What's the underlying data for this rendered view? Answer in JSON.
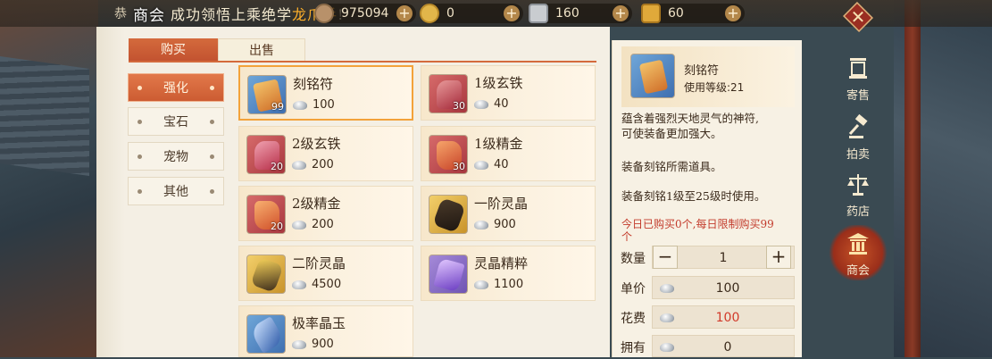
{
  "header": {
    "title": "商会",
    "announcement_prefix": "恭",
    "announcement_mid": "成功领悟上乘绝学",
    "announcement_highlight": "龙爪手",
    "announcement_end": "!"
  },
  "currencies": [
    {
      "name": "coin",
      "value": "975094",
      "icon": "coin-icon",
      "color": "#b8916a"
    },
    {
      "name": "gold-ingot",
      "value": "0",
      "icon": "gold-coin-icon",
      "color": "#e2b64a"
    },
    {
      "name": "silver-bar",
      "value": "160",
      "icon": "silver-bar-icon",
      "color": "#c9ccd0"
    },
    {
      "name": "gold-bar",
      "value": "60",
      "icon": "gold-bar-icon",
      "color": "#e0a93a"
    }
  ],
  "tabs": {
    "buy": "购买",
    "sell": "出售"
  },
  "categories": [
    "强化",
    "宝石",
    "宠物",
    "其他"
  ],
  "items": [
    {
      "name": "刻铭符",
      "price": "100",
      "count": "99",
      "bg": "blue",
      "icon": "talisman-icon"
    },
    {
      "name": "1级玄铁",
      "price": "40",
      "count": "30",
      "bg": "red",
      "icon": "iron-ore-icon"
    },
    {
      "name": "2级玄铁",
      "price": "200",
      "count": "20",
      "bg": "red",
      "icon": "iron-ore-icon"
    },
    {
      "name": "1级精金",
      "price": "40",
      "count": "30",
      "bg": "red",
      "icon": "gold-ore-icon"
    },
    {
      "name": "2级精金",
      "price": "200",
      "count": "20",
      "bg": "red",
      "icon": "gold-ore-icon"
    },
    {
      "name": "一阶灵晶",
      "price": "900",
      "count": "",
      "bg": "gold",
      "icon": "crystal-icon"
    },
    {
      "name": "二阶灵晶",
      "price": "4500",
      "count": "",
      "bg": "gold",
      "icon": "crystal-icon"
    },
    {
      "name": "灵晶精粹",
      "price": "1100",
      "count": "",
      "bg": "purple",
      "icon": "essence-icon"
    },
    {
      "name": "极率晶玉",
      "price": "900",
      "count": "",
      "bg": "blue",
      "icon": "jade-icon"
    }
  ],
  "detail": {
    "name": "刻铭符",
    "level_label": "使用等级:",
    "level": "21",
    "desc1_line1": "蕴含着强烈天地灵气的神符,",
    "desc1_line2": "可使装备更加强大。",
    "desc2": "装备刻铭所需道具。",
    "desc3": "装备刻铭1级至25级时使用。",
    "limit_line1": "今日已购买0个,每日限制购买99",
    "limit_line2": "个",
    "qty_label": "数量",
    "qty_value": "1",
    "minus": "−",
    "plus": "+",
    "unit_label": "单价",
    "unit_value": "100",
    "cost_label": "花费",
    "cost_value": "100",
    "own_label": "拥有",
    "own_value": "0"
  },
  "nav": [
    {
      "label": "寄售",
      "icon": "consign-icon",
      "active": false
    },
    {
      "label": "拍卖",
      "icon": "auction-gavel-icon",
      "active": false
    },
    {
      "label": "药店",
      "icon": "scales-icon",
      "active": false
    },
    {
      "label": "商会",
      "icon": "guild-hall-icon",
      "active": true
    }
  ]
}
